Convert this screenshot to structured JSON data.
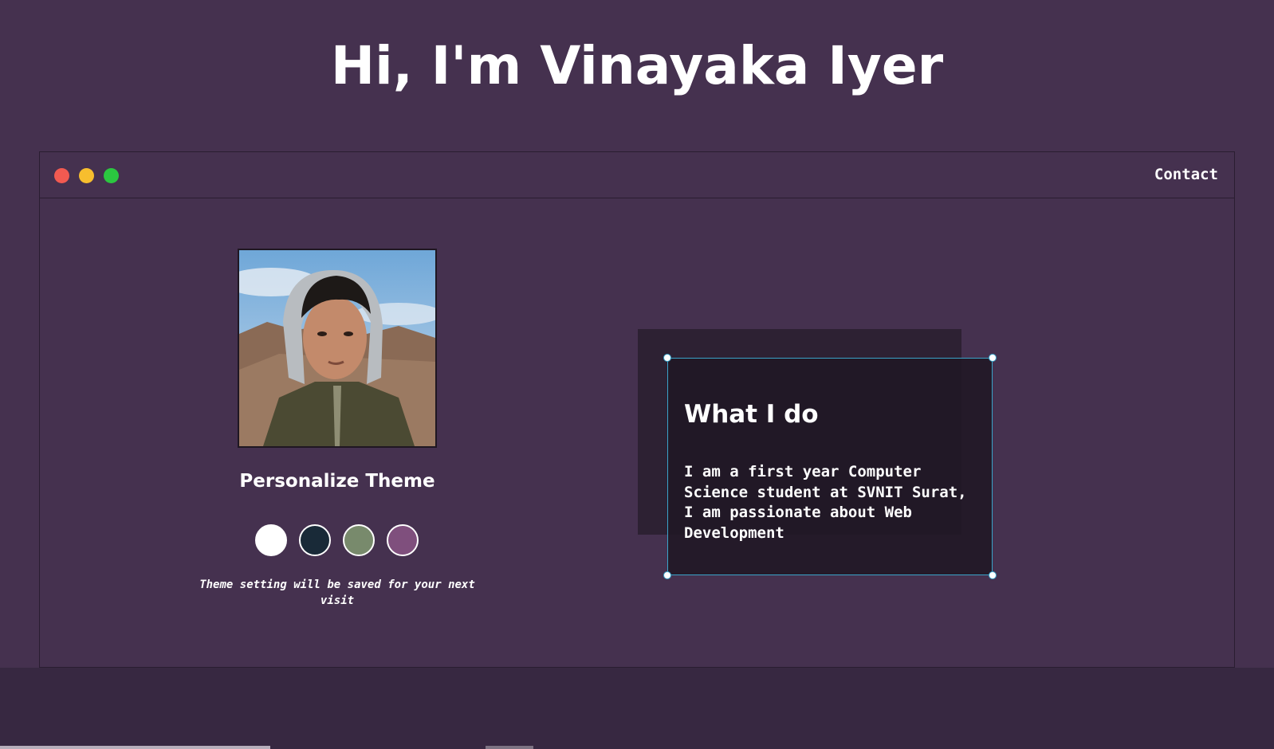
{
  "header": {
    "title": "Hi, I'm Vinayaka Iyer"
  },
  "window": {
    "controls": [
      "close",
      "minimize",
      "maximize"
    ],
    "nav": {
      "contact_label": "Contact"
    }
  },
  "profile": {
    "photo_alt": "Profile photo"
  },
  "theme": {
    "heading": "Personalize Theme",
    "swatches": [
      {
        "name": "light",
        "color": "#ffffff"
      },
      {
        "name": "dark-blue",
        "color": "#192a38"
      },
      {
        "name": "green",
        "color": "#788a6c"
      },
      {
        "name": "purple",
        "color": "#7f4f7d"
      }
    ],
    "note": "Theme setting will be saved for your next visit"
  },
  "about": {
    "title": "What I do",
    "body": "I am a first year Computer Science student at SVNIT Surat, I am passionate about Web Development"
  },
  "colors": {
    "background": "#45314f",
    "card_border": "#3aa3c9",
    "window_close": "#f25a51",
    "window_minimize": "#f7be2e",
    "window_maximize": "#2bc740"
  }
}
